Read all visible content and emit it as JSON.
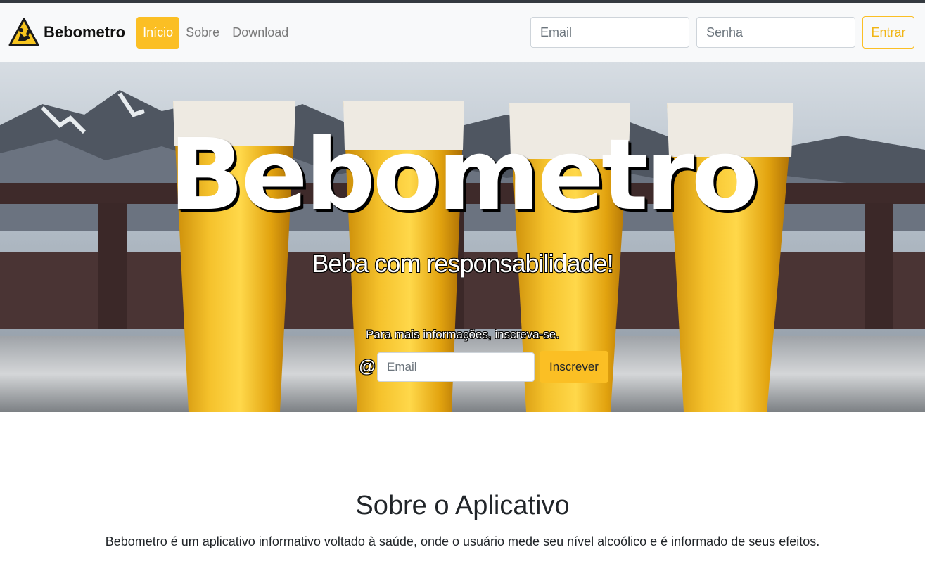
{
  "navbar": {
    "brand_name": "Bebometro",
    "brand_icon": "warning-drinker-icon",
    "links": [
      {
        "label": "Início",
        "active": true
      },
      {
        "label": "Sobre",
        "active": false
      },
      {
        "label": "Download",
        "active": false
      }
    ],
    "email_placeholder": "Email",
    "password_placeholder": "Senha",
    "login_button": "Entrar"
  },
  "hero": {
    "title": "Bebometro",
    "subtitle": "Beba com responsabilidade!",
    "info": "Para mais informações, inscreva-se.",
    "at_symbol": "@",
    "email_placeholder": "Email",
    "subscribe_button": "Inscrever",
    "background_image": "beer-glasses-mountains"
  },
  "about": {
    "title": "Sobre o Aplicativo",
    "text": "Bebometro é um aplicativo informativo voltado à saúde, onde o usuário mede seu nível alcoólico e é informado de seus efeitos."
  },
  "colors": {
    "accent": "#fbbf24",
    "navbar_bg": "#f8f9fa",
    "top_strip": "#343a40"
  }
}
